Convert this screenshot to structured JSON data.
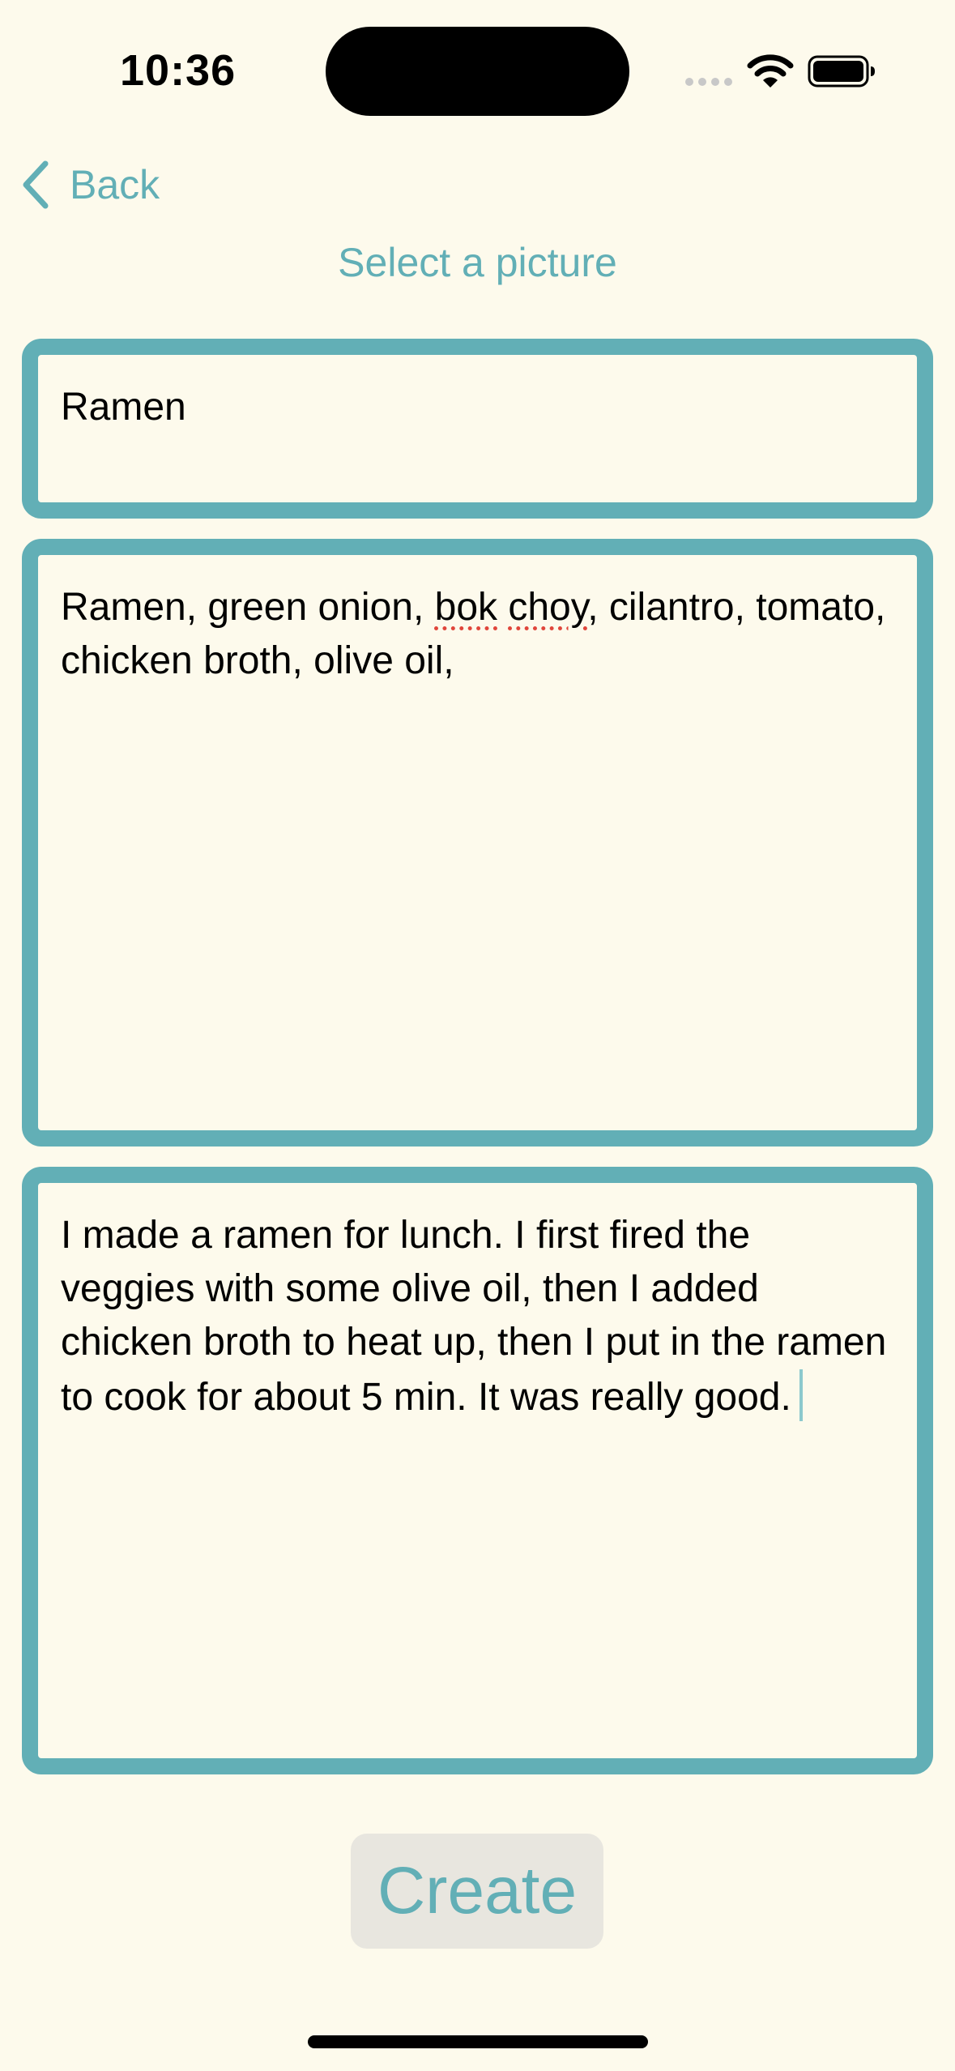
{
  "status_bar": {
    "time": "10:36",
    "icons": [
      "cellular-signal-icon",
      "wifi-icon",
      "battery-icon"
    ]
  },
  "nav": {
    "back_label": "Back",
    "back_icon": "chevron-left-icon",
    "title": "Select a picture"
  },
  "form": {
    "title_value": "Ramen",
    "ingredients_value_parts": [
      "Ramen, green onion, ",
      "bok",
      " ",
      "choy",
      ", cilantro, tomato, chicken broth, olive oil,"
    ],
    "notes_value": "I made a ramen for lunch. I first fired the veggies with some olive oil, then I added chicken broth to heat up, then I put in the ramen to cook for about 5 min. It was really good."
  },
  "actions": {
    "create_label": "Create"
  },
  "colors": {
    "background": "#FDFAEC",
    "accent": "#62AFB6",
    "button_background": "#E8E6DF",
    "spellcheck": "#E0463B"
  }
}
